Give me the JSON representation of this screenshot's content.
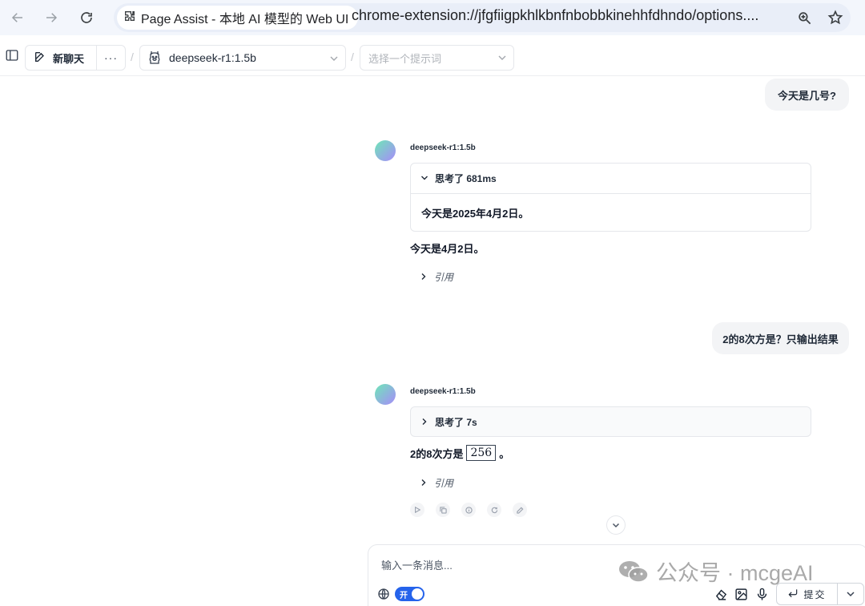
{
  "browser": {
    "tab_title": "Page Assist - 本地 AI 模型的 Web UI",
    "url": "chrome-extension://jfgfiigpkhlkbnfnbobbkinehhfdhndo/options...."
  },
  "toolbar": {
    "new_chat_label": "新聊天",
    "more_label": "···",
    "separator": "/",
    "model_selected": "deepseek-r1:1.5b",
    "prompt_placeholder": "选择一个提示词"
  },
  "messages": [
    {
      "role": "user",
      "text": "今天是几号?"
    },
    {
      "role": "assistant",
      "model": "deepseek-r1:1.5b",
      "thinking_label": "思考了 681ms",
      "thinking_content": "今天是2025年4月2日。",
      "answer": "今天是4月2日。",
      "citation_label": "引用"
    },
    {
      "role": "user",
      "text": "2的8次方是？只输出结果"
    },
    {
      "role": "assistant",
      "model": "deepseek-r1:1.5b",
      "thinking_label": "思考了 7s",
      "answer_prefix": "2的8次方是",
      "answer_math": "256",
      "answer_suffix": "。",
      "citation_label": "引用"
    }
  ],
  "composer": {
    "placeholder": "输入一条消息...",
    "web_search_toggle": "开",
    "submit_label": "提交"
  },
  "watermark": {
    "text": "公众号 · mcgeAI"
  },
  "icons": {
    "back": "back-arrow-icon",
    "forward": "forward-arrow-icon",
    "reload": "reload-icon",
    "extension": "extension-puzzle-icon",
    "zoom": "zoom-icon",
    "bookmark": "star-icon"
  },
  "colors": {
    "accent": "#2563eb",
    "chrome_bg": "#f3f6fc",
    "bubble_bg": "#f3f4f6"
  }
}
